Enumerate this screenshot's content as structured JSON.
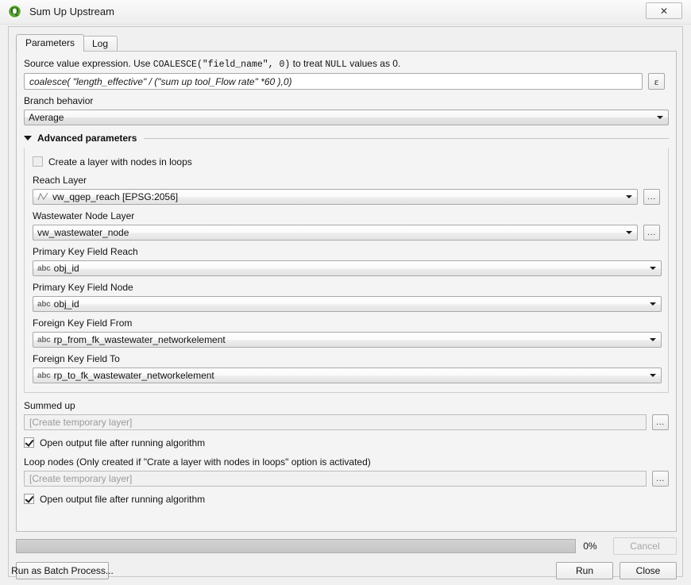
{
  "window": {
    "title": "Sum Up Upstream",
    "logo_icon": "qgis-logo-icon",
    "logo_letter": "Q",
    "close_icon": "✕"
  },
  "tabs": [
    {
      "label": "Parameters",
      "name": "tab-parameters",
      "active": true
    },
    {
      "label": "Log",
      "name": "tab-log",
      "active": false
    }
  ],
  "expression": {
    "description_prefix": "Source value expression. Use ",
    "description_code": "COALESCE(\"field_name\", 0)",
    "description_suffix": " to treat ",
    "description_null": "NULL",
    "description_end": " values as 0.",
    "value": "coalesce( \"length_effective\" / (\"sum up tool_Flow rate\" *60 ),0)",
    "expression_button_label": "ε"
  },
  "branch_behavior": {
    "label": "Branch behavior",
    "value": "Average"
  },
  "advanced": {
    "title": "Advanced parameters",
    "caret_icon": "caret-down-icon",
    "loops_checkbox": {
      "label": "Create a layer with nodes in loops",
      "checked": false
    },
    "fields": [
      {
        "label": "Reach Layer",
        "value": "vw_qgep_reach [EPSG:2056]",
        "icon": "line-geometry-icon",
        "has_browse": true,
        "browse_label": "..."
      },
      {
        "label": "Wastewater Node Layer",
        "value": "vw_wastewater_node",
        "icon": "none",
        "has_browse": true,
        "browse_label": "..."
      },
      {
        "label": "Primary Key Field Reach",
        "value": "obj_id",
        "icon": "abc-field-icon",
        "icon_text": "abc",
        "has_browse": false
      },
      {
        "label": "Primary Key Field Node",
        "value": "obj_id",
        "icon": "abc-field-icon",
        "icon_text": "abc",
        "has_browse": false
      },
      {
        "label": "Foreign Key Field From",
        "value": "rp_from_fk_wastewater_networkelement",
        "icon": "abc-field-icon",
        "icon_text": "abc",
        "has_browse": false
      },
      {
        "label": "Foreign Key Field To",
        "value": "rp_to_fk_wastewater_networkelement",
        "icon": "abc-field-icon",
        "icon_text": "abc",
        "has_browse": false
      }
    ]
  },
  "outputs": [
    {
      "label": "Summed up",
      "placeholder": "[Create temporary layer]",
      "browse_label": "...",
      "open_after": {
        "label": "Open output file after running algorithm",
        "checked": true
      }
    },
    {
      "label": "Loop nodes (Only created if \"Crate a layer with nodes in loops\" option is activated)",
      "placeholder": "[Create temporary layer]",
      "browse_label": "...",
      "open_after": {
        "label": "Open output file after running algorithm",
        "checked": true
      }
    }
  ],
  "footer": {
    "progress_percent_label": "0%",
    "progress_value": 0,
    "cancel_label": "Cancel",
    "cancel_enabled": false,
    "batch_label": "Run as Batch Process...",
    "run_label": "Run",
    "close_label": "Close"
  }
}
